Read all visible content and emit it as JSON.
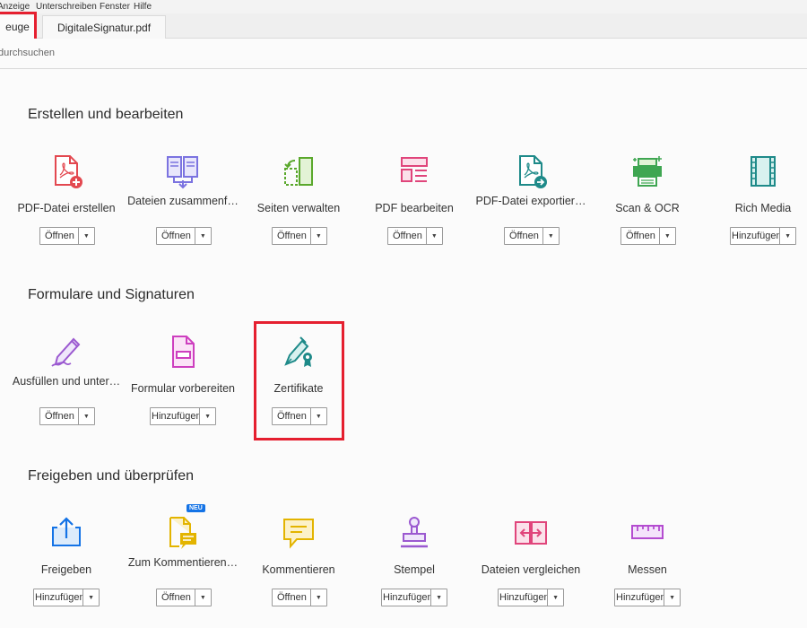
{
  "menu": [
    "Anzeige",
    "Unterschreiben",
    "Fenster",
    "Hilfe"
  ],
  "tabs": {
    "home": "euge",
    "doc": "DigitaleSignatur.pdf"
  },
  "search": {
    "text": "durchsuchen"
  },
  "sections": [
    {
      "title": "Erstellen und bearbeiten",
      "tools": [
        {
          "label": "PDF-Datei erstellen",
          "button": "Öffnen",
          "icon": "pdf-create-icon"
        },
        {
          "label": "Dateien zusammenf…",
          "button": "Öffnen",
          "icon": "combine-files-icon"
        },
        {
          "label": "Seiten verwalten",
          "button": "Öffnen",
          "icon": "organize-pages-icon"
        },
        {
          "label": "PDF bearbeiten",
          "button": "Öffnen",
          "icon": "edit-pdf-icon"
        },
        {
          "label": "PDF-Datei exportier…",
          "button": "Öffnen",
          "icon": "export-pdf-icon"
        },
        {
          "label": "Scan & OCR",
          "button": "Öffnen",
          "icon": "scan-icon"
        },
        {
          "label": "Rich Media",
          "button": "Hinzufügen",
          "icon": "film-icon"
        }
      ]
    },
    {
      "title": "Formulare und Signaturen",
      "tools": [
        {
          "label": "Ausfüllen und unter…",
          "button": "Öffnen",
          "icon": "fill-sign-icon"
        },
        {
          "label": "Formular vorbereiten",
          "button": "Hinzufügen",
          "icon": "form-icon"
        },
        {
          "label": "Zertifikate",
          "button": "Öffnen",
          "icon": "certificate-icon"
        }
      ]
    },
    {
      "title": "Freigeben und überprüfen",
      "tools": [
        {
          "label": "Freigeben",
          "button": "Hinzufügen",
          "icon": "share-icon"
        },
        {
          "label": "Zum Kommentieren…",
          "button": "Öffnen",
          "icon": "send-comment-icon",
          "badge": "NEU"
        },
        {
          "label": "Kommentieren",
          "button": "Öffnen",
          "icon": "comment-icon"
        },
        {
          "label": "Stempel",
          "button": "Hinzufügen",
          "icon": "stamp-icon"
        },
        {
          "label": "Dateien vergleichen",
          "button": "Hinzufügen",
          "icon": "compare-icon"
        },
        {
          "label": "Messen",
          "button": "Hinzufügen",
          "icon": "measure-icon"
        }
      ]
    }
  ]
}
